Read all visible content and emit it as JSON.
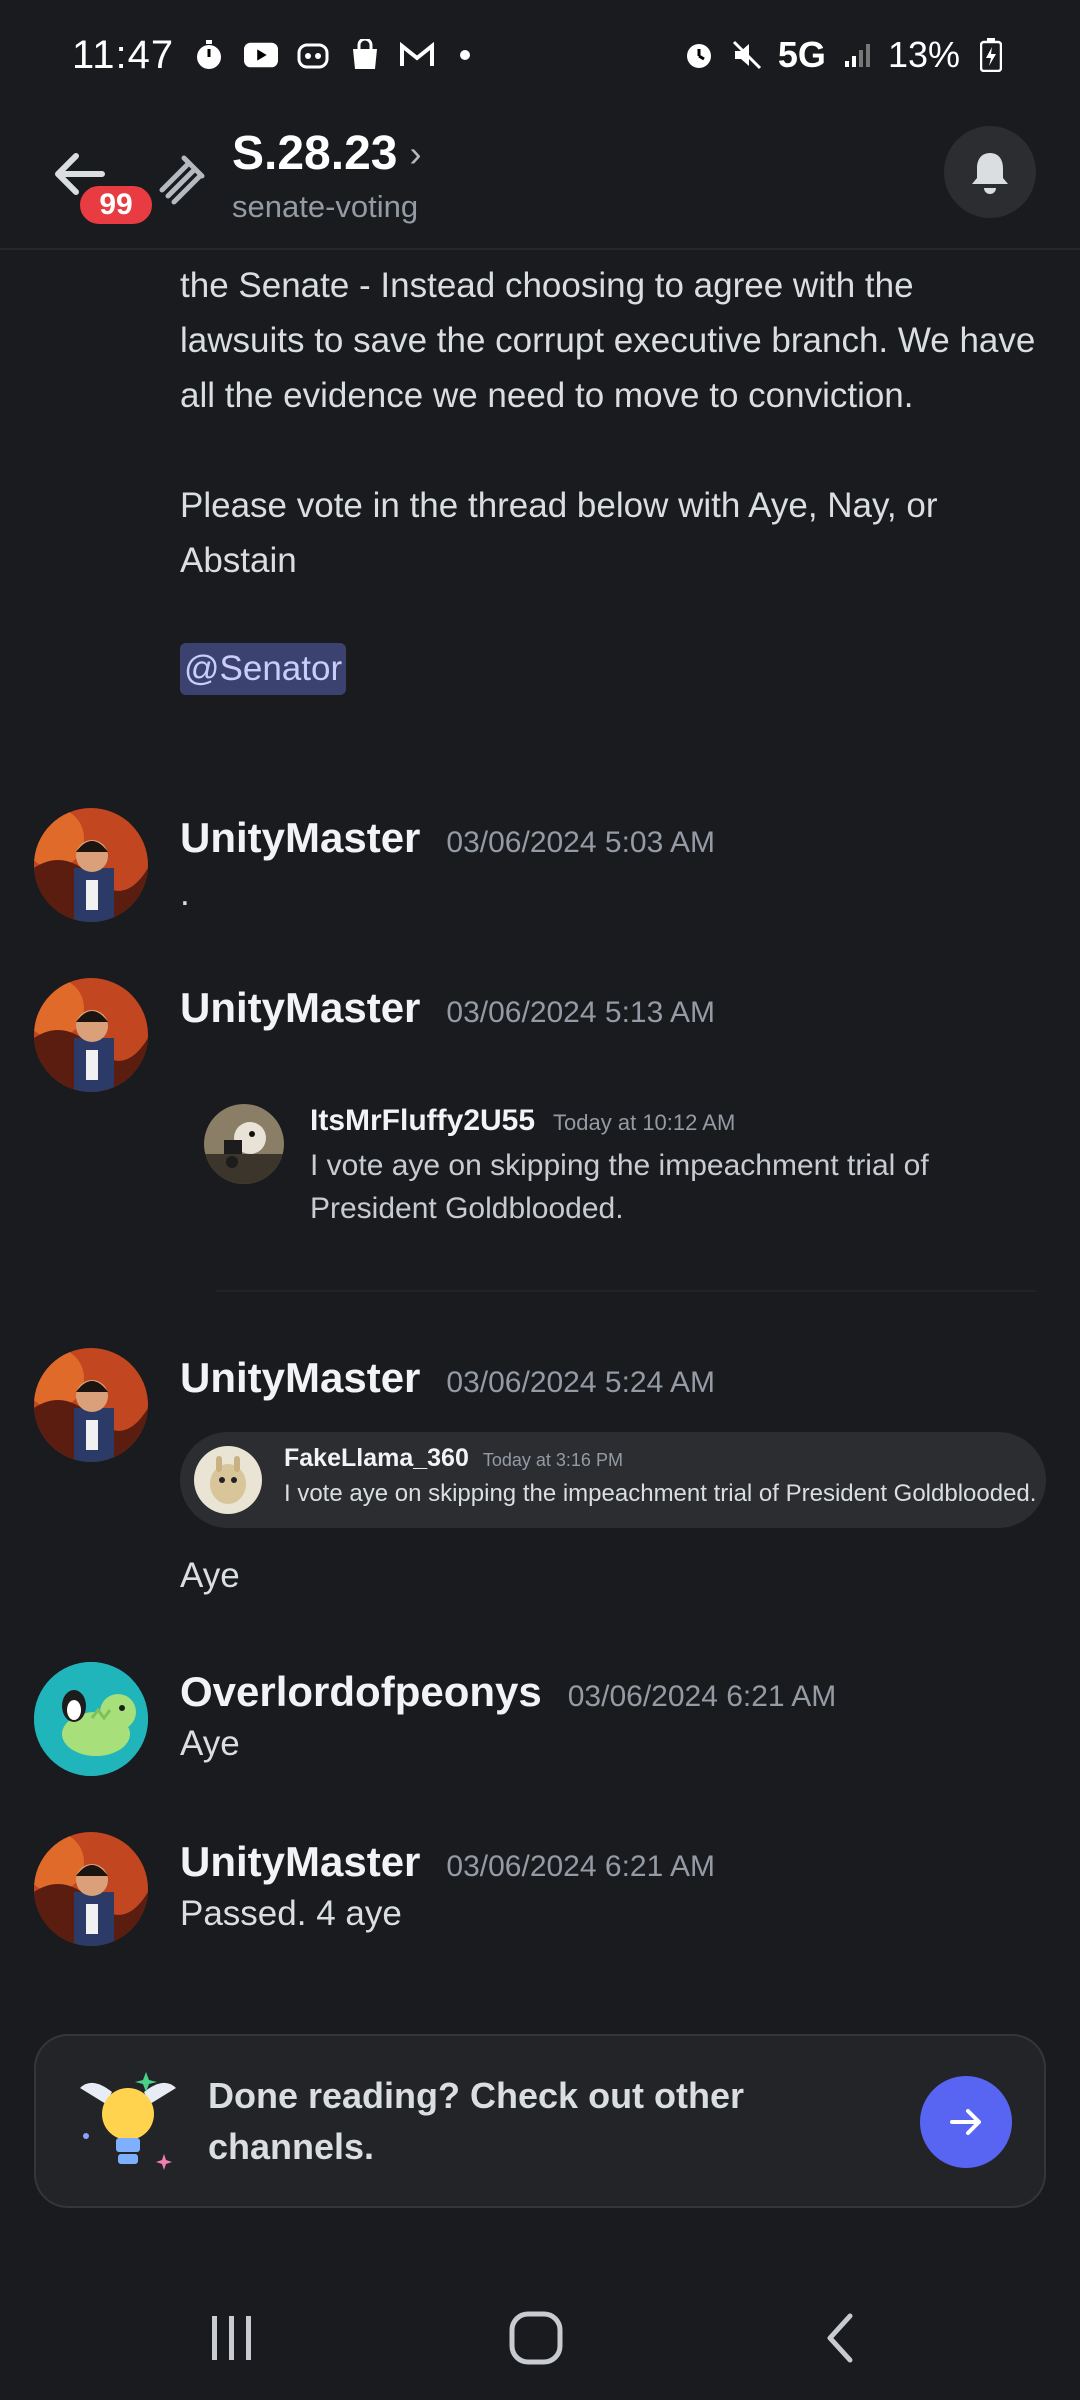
{
  "status_bar": {
    "time": "11:47",
    "network": "5G",
    "battery": "13%",
    "left_icons": [
      "timer-icon",
      "youtube-icon",
      "discord-icon",
      "shopping-bag-icon",
      "gmail-icon",
      "dot-icon"
    ],
    "right_icons": [
      "alarm-icon",
      "mute-icon",
      "signal-icon",
      "battery-charging-icon"
    ]
  },
  "header": {
    "unread_badge": "99",
    "title": "S.28.23",
    "subtitle": "senate-voting"
  },
  "partial_message": {
    "paragraph1": "the Senate - Instead choosing to agree with the lawsuits to save the corrupt executive branch. We have all the evidence we need to move to conviction.",
    "paragraph2": "Please vote in the thread below with Aye, Nay, or Abstain",
    "mention": "@Senator"
  },
  "messages": [
    {
      "author": "UnityMaster",
      "timestamp": "03/06/2024 5:03 AM",
      "text": "."
    },
    {
      "author": "UnityMaster",
      "timestamp": "03/06/2024 5:13 AM",
      "embed": {
        "author": "ItsMrFluffy2U55",
        "time": "Today at 10:12 AM",
        "text": "I vote aye on skipping the impeachment trial of President Goldblooded."
      }
    },
    {
      "author": "UnityMaster",
      "timestamp": "03/06/2024 5:24 AM",
      "embed": {
        "author": "FakeLlama_360",
        "time": "Today at 3:16 PM",
        "text": "I vote aye on skipping the impeachment trial of President Goldblooded."
      },
      "text": "Aye"
    },
    {
      "author": "Overlordofpeonys",
      "timestamp": "03/06/2024 6:21 AM",
      "text": "Aye"
    },
    {
      "author": "UnityMaster",
      "timestamp": "03/06/2024 6:21 AM",
      "text": "Passed. 4 aye"
    }
  ],
  "done_card": {
    "text": "Done reading? Check out other channels."
  },
  "colors": {
    "background": "#1a1b1e",
    "accent": "#5865f2",
    "badge": "#e93b42",
    "mention_bg": "#3c4270"
  }
}
